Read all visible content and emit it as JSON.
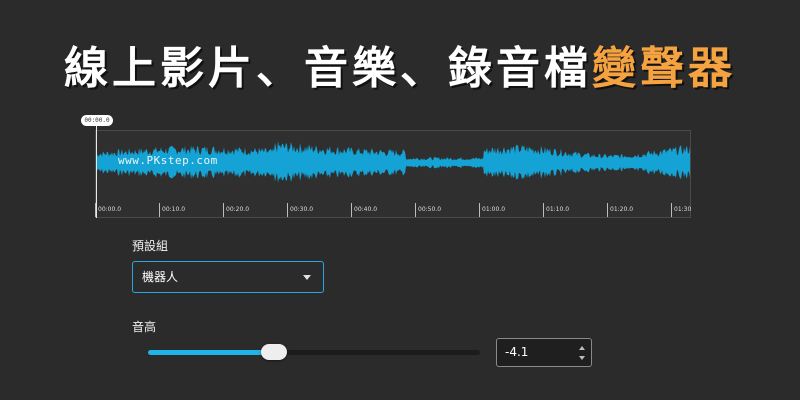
{
  "title": {
    "main": "線上影片、音樂、錄音檔",
    "accent": "變聲器"
  },
  "waveform": {
    "playhead_time": "00:00.0",
    "watermark": "www.PKstep.com",
    "ticks": [
      "00:00.0",
      "00:10.0",
      "00:20.0",
      "00:30.0",
      "00:40.0",
      "00:50.0",
      "01:00.0",
      "01:10.0",
      "01:20.0",
      "01:30"
    ],
    "color": "#14a3d4"
  },
  "preset": {
    "label": "預設組",
    "value": "機器人"
  },
  "pitch": {
    "label": "音高",
    "value": "-4.1",
    "slider_fraction": 0.38
  },
  "colors": {
    "accent": "#f4a340",
    "slider": "#1fb5e8",
    "focus_border": "#2ba7e0"
  }
}
